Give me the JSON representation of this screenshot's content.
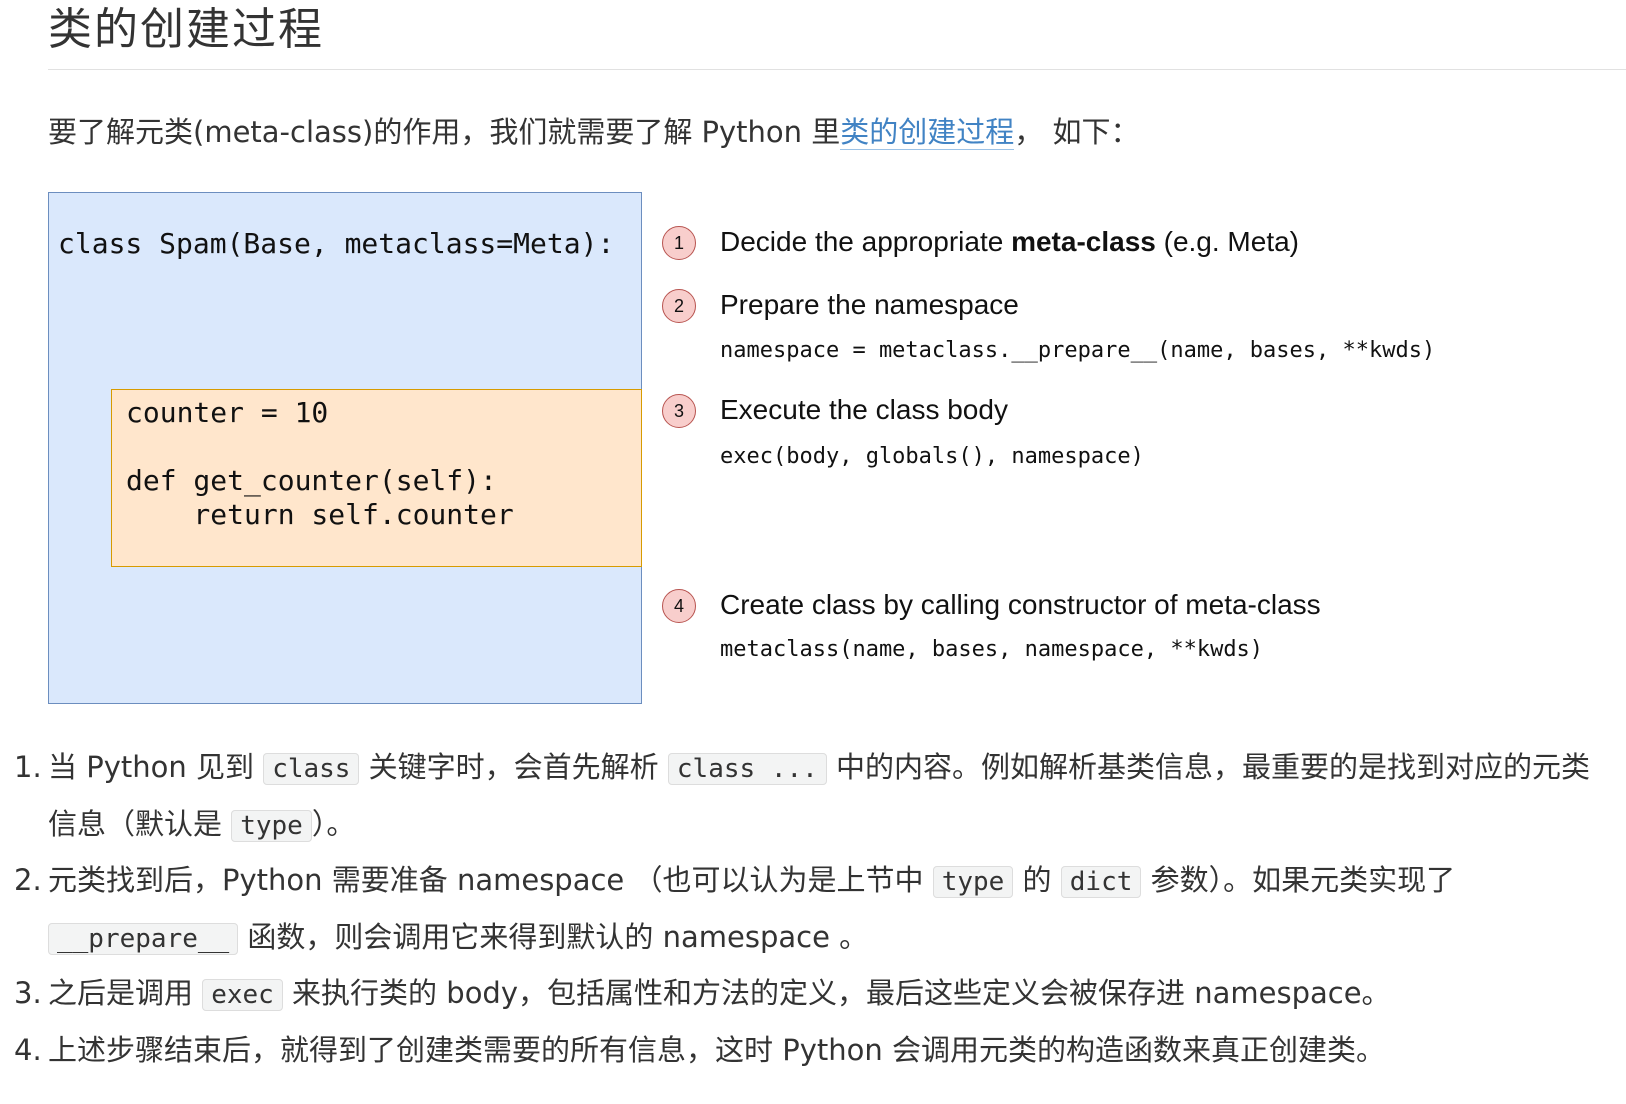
{
  "heading": "类的创建过程",
  "intro": {
    "before": "要了解元类(meta-class)的作用，我们就需要了解 Python 里",
    "link": "类的创建过程",
    "after": "，  如下："
  },
  "diagram": {
    "class_line": "class Spam(Base, metaclass=Meta):",
    "body_code": "counter = 10\n\ndef get_counter(self):\n    return self.counter",
    "steps": [
      {
        "num": "1",
        "title_before": "Decide the appropriate ",
        "title_bold": "meta-class",
        "title_after": " (e.g. Meta)",
        "code": ""
      },
      {
        "num": "2",
        "title": "Prepare the namespace",
        "code": "namespace = metaclass.__prepare__(name, bases, **kwds)"
      },
      {
        "num": "3",
        "title": "Execute the class body",
        "code": "exec(body, globals(), namespace)"
      },
      {
        "num": "4",
        "title": "Create class by calling constructor of meta-class",
        "code": "metaclass(name, bases, namespace, **kwds)"
      }
    ],
    "colors": {
      "blue_fill": "#dae8fc",
      "blue_border": "#6c8ebf",
      "orange_fill": "#ffe6cc",
      "orange_border": "#d79b00",
      "badge_fill": "#f8cecc",
      "badge_border": "#b85450",
      "link": "#4183c4"
    }
  },
  "notes": [
    {
      "num": "1.",
      "t1": "当 Python 见到 ",
      "c1": "class",
      "t2": " 关键字时，会首先解析 ",
      "c2": "class ...",
      "t3": " 中的内容。例如解析基类信息，最重要的是找到对应的元类信息（默认是 ",
      "c3": "type",
      "t4": "）。"
    },
    {
      "num": "2.",
      "t1": "元类找到后，Python 需要准备 namespace （也可以认为是上节中 ",
      "c1": "type",
      "t2": " 的 ",
      "c2": "dict",
      "t3": " 参数）。如果元类实现了 ",
      "c3": "__prepare__",
      "t4": " 函数，则会调用它来得到默认的 namespace 。"
    },
    {
      "num": "3.",
      "t1": "之后是调用 ",
      "c1": "exec",
      "t2": " 来执行类的 body，包括属性和方法的定义，最后这些定义会被保存进 namespace。"
    },
    {
      "num": "4.",
      "t1": "上述步骤结束后，就得到了创建类需要的所有信息，这时 Python 会调用元类的构造函数来真正创建类。"
    }
  ]
}
